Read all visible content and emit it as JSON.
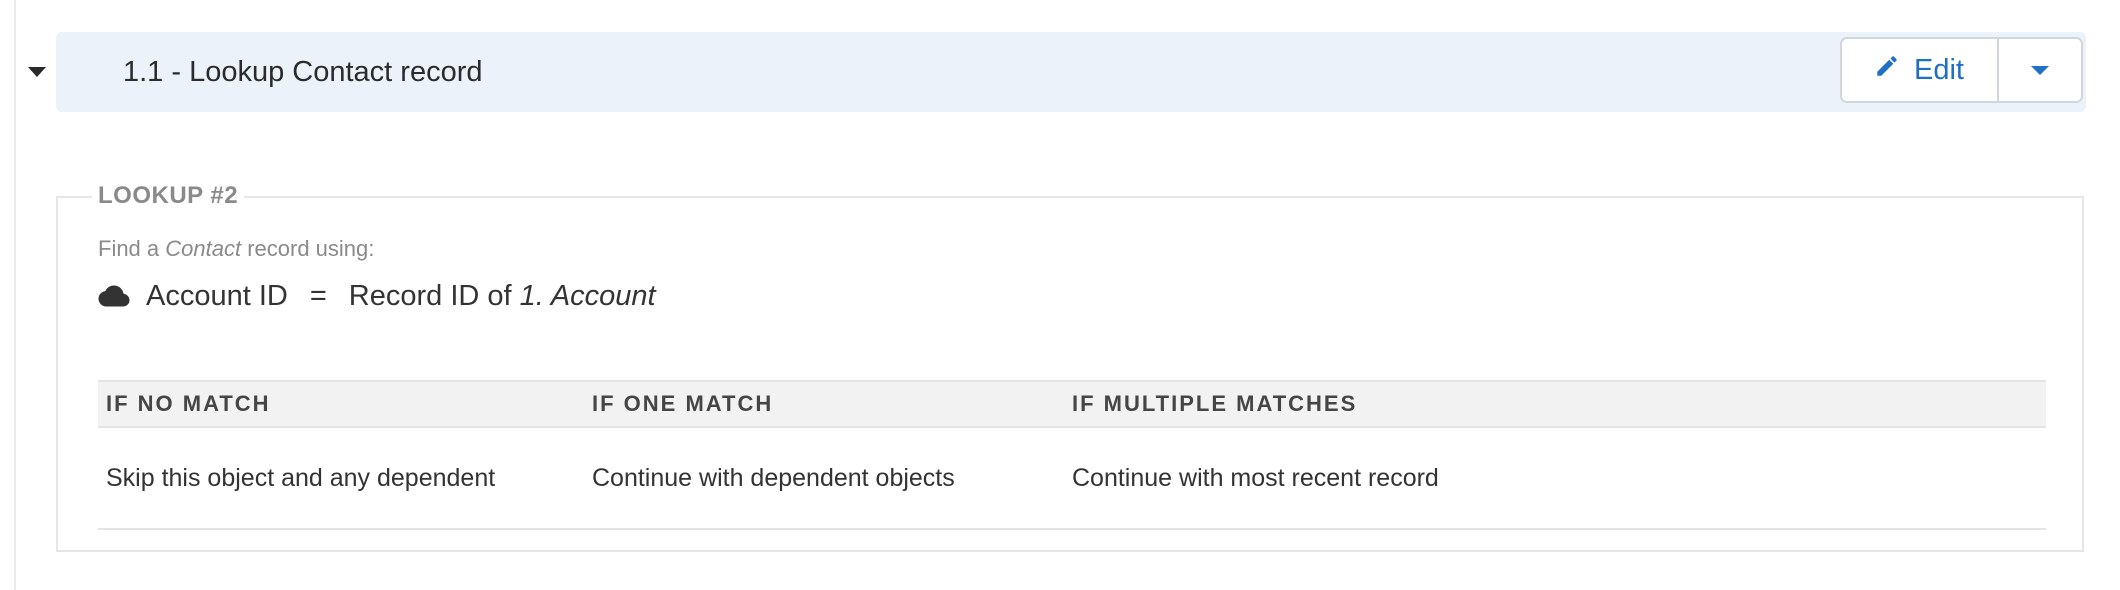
{
  "step": {
    "title": "1.1 - Lookup Contact record",
    "edit_label": "Edit"
  },
  "lookup": {
    "legend": "LOOKUP #2",
    "find_prefix": "Find a ",
    "find_object": "Contact",
    "find_suffix": " record using:",
    "condition": {
      "icon": "cloud-icon",
      "field": "Account ID",
      "operator": "=",
      "value_prefix": "Record ID of ",
      "value_source": "1. Account"
    },
    "table": {
      "headers": [
        "IF NO MATCH",
        "IF ONE MATCH",
        "IF MULTIPLE MATCHES"
      ],
      "row": [
        "Skip this object and any dependent",
        "Continue with dependent objects",
        "Continue with most recent record"
      ]
    }
  },
  "colors": {
    "accent": "#1f6fc5",
    "header_bg": "#ebf2f9"
  }
}
